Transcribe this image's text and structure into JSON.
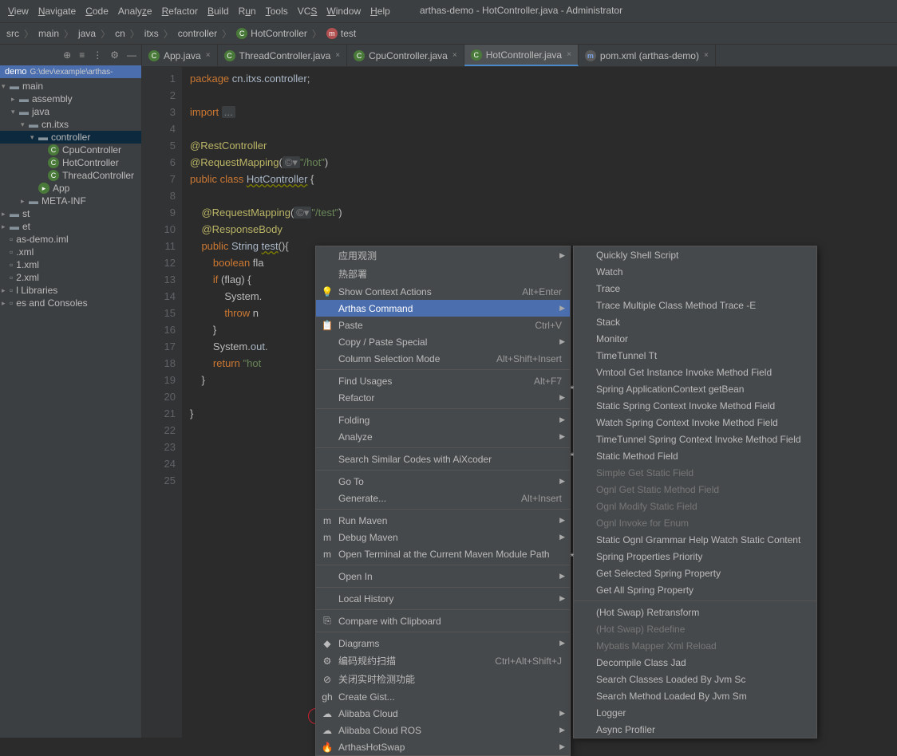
{
  "title": "arthas-demo - HotController.java - Administrator",
  "menu": [
    "View",
    "Navigate",
    "Code",
    "Analyze",
    "Refactor",
    "Build",
    "Run",
    "Tools",
    "VCS",
    "Window",
    "Help"
  ],
  "breadcrumb": [
    "src",
    "main",
    "java",
    "cn",
    "itxs",
    "controller",
    "HotController",
    "test"
  ],
  "project": {
    "name": "demo",
    "path": "G:\\dev\\example\\arthas-"
  },
  "tree": [
    {
      "ind": 0,
      "arrow": "▾",
      "icon": "folder",
      "label": "main"
    },
    {
      "ind": 1,
      "arrow": "▸",
      "icon": "folder",
      "label": "assembly"
    },
    {
      "ind": 1,
      "arrow": "▾",
      "icon": "folder",
      "label": "java"
    },
    {
      "ind": 2,
      "arrow": "▾",
      "icon": "folder",
      "label": "cn.itxs"
    },
    {
      "ind": 3,
      "arrow": "▾",
      "icon": "folder",
      "label": "controller",
      "sel": true
    },
    {
      "ind": 4,
      "arrow": "",
      "icon": "class",
      "label": "CpuController"
    },
    {
      "ind": 4,
      "arrow": "",
      "icon": "class",
      "label": "HotController"
    },
    {
      "ind": 4,
      "arrow": "",
      "icon": "class",
      "label": "ThreadController"
    },
    {
      "ind": 3,
      "arrow": "",
      "icon": "app",
      "label": "App"
    },
    {
      "ind": 2,
      "arrow": "▸",
      "icon": "folder",
      "label": "META-INF"
    },
    {
      "ind": 0,
      "arrow": "▸",
      "icon": "folder",
      "label": "st"
    },
    {
      "ind": 0,
      "arrow": "▸",
      "icon": "folder",
      "label": "et"
    },
    {
      "ind": 0,
      "arrow": "",
      "icon": "file",
      "label": "as-demo.iml"
    },
    {
      "ind": 0,
      "arrow": "",
      "icon": "file",
      "label": ".xml"
    },
    {
      "ind": 0,
      "arrow": "",
      "icon": "file",
      "label": "1.xml"
    },
    {
      "ind": 0,
      "arrow": "",
      "icon": "file",
      "label": "2.xml"
    },
    {
      "ind": 0,
      "arrow": "▸",
      "icon": "lib",
      "label": "l Libraries"
    },
    {
      "ind": 0,
      "arrow": "▸",
      "icon": "lib",
      "label": "es and Consoles"
    }
  ],
  "tabs": [
    {
      "icon": "class",
      "label": "App.java",
      "active": false
    },
    {
      "icon": "class",
      "label": "ThreadController.java",
      "active": false
    },
    {
      "icon": "class",
      "label": "CpuController.java",
      "active": false
    },
    {
      "icon": "class",
      "label": "HotController.java",
      "active": true
    },
    {
      "icon": "maven",
      "label": "pom.xml (arthas-demo)",
      "active": false
    }
  ],
  "code_lines": 25,
  "ctx1": [
    {
      "label": "应用观测",
      "sub": true,
      "boxed": true
    },
    {
      "label": "热部署",
      "boxed": true
    },
    {
      "icon": "💡",
      "label": "Show Context Actions",
      "shortcut": "Alt+Enter"
    },
    {
      "label": "Arthas Command",
      "sub": true,
      "hl": true,
      "circled": true
    },
    {
      "icon": "📋",
      "label": "Paste",
      "shortcut": "Ctrl+V"
    },
    {
      "label": "Copy / Paste Special",
      "sub": true
    },
    {
      "label": "Column Selection Mode",
      "shortcut": "Alt+Shift+Insert"
    },
    {
      "sep": true
    },
    {
      "label": "Find Usages",
      "shortcut": "Alt+F7"
    },
    {
      "label": "Refactor",
      "sub": true
    },
    {
      "sep": true
    },
    {
      "label": "Folding",
      "sub": true
    },
    {
      "label": "Analyze",
      "sub": true
    },
    {
      "sep": true
    },
    {
      "label": "Search Similar Codes with AiXcoder"
    },
    {
      "sep": true
    },
    {
      "label": "Go To",
      "sub": true
    },
    {
      "label": "Generate...",
      "shortcut": "Alt+Insert"
    },
    {
      "sep": true
    },
    {
      "icon": "m",
      "label": "Run Maven",
      "sub": true
    },
    {
      "icon": "m",
      "label": "Debug Maven",
      "sub": true
    },
    {
      "icon": "m",
      "label": "Open Terminal at the Current Maven Module Path"
    },
    {
      "sep": true
    },
    {
      "label": "Open In",
      "sub": true
    },
    {
      "sep": true
    },
    {
      "label": "Local History",
      "sub": true
    },
    {
      "sep": true
    },
    {
      "icon": "⎘",
      "label": "Compare with Clipboard"
    },
    {
      "sep": true
    },
    {
      "icon": "◆",
      "label": "Diagrams",
      "sub": true
    },
    {
      "icon": "⚙",
      "label": "编码规约扫描",
      "shortcut": "Ctrl+Alt+Shift+J"
    },
    {
      "icon": "⊘",
      "label": "关闭实时检测功能"
    },
    {
      "icon": "gh",
      "label": "Create Gist..."
    },
    {
      "icon": "☁",
      "label": "Alibaba Cloud",
      "sub": true
    },
    {
      "icon": "☁",
      "label": "Alibaba Cloud ROS",
      "sub": true
    },
    {
      "icon": "🔥",
      "label": "ArthasHotSwap",
      "sub": true,
      "circled2": true
    }
  ],
  "ctx2": [
    {
      "label": "Quickly Shell Script"
    },
    {
      "label": "Watch"
    },
    {
      "label": "Trace"
    },
    {
      "label": "Trace Multiple Class Method Trace -E"
    },
    {
      "label": "Stack"
    },
    {
      "label": "Monitor"
    },
    {
      "label": "TimeTunnel Tt"
    },
    {
      "label": "Vmtool Get Instance Invoke Method Field"
    },
    {
      "star": true,
      "label": "Spring ApplicationContext getBean"
    },
    {
      "label": "Static Spring Context Invoke  Method Field"
    },
    {
      "label": "Watch Spring Context Invoke Method Field"
    },
    {
      "label": "TimeTunnel Spring Context Invoke Method Field"
    },
    {
      "star": true,
      "label": "Static Method Field"
    },
    {
      "label": "Simple Get Static Field",
      "disabled": true
    },
    {
      "label": "Ognl Get Static Method Field",
      "disabled": true
    },
    {
      "label": "Ognl Modify Static Field",
      "disabled": true
    },
    {
      "label": "Ognl Invoke for Enum",
      "disabled": true
    },
    {
      "label": "Static Ognl Grammar Help Watch Static Content"
    },
    {
      "star": true,
      "label": "Spring Properties Priority"
    },
    {
      "label": "Get Selected Spring Property"
    },
    {
      "label": "Get All Spring Property"
    },
    {
      "sep": true
    },
    {
      "label": "(Hot Swap) Retransform"
    },
    {
      "label": "(Hot Swap) Redefine",
      "disabled": true
    },
    {
      "label": "Mybatis Mapper Xml Reload",
      "disabled": true
    },
    {
      "label": "Decompile Class Jad"
    },
    {
      "label": "Search Classes Loaded By Jvm Sc"
    },
    {
      "label": "Search Method Loaded By Jvm Sm"
    },
    {
      "label": "Logger"
    },
    {
      "label": "Async Profiler"
    }
  ]
}
